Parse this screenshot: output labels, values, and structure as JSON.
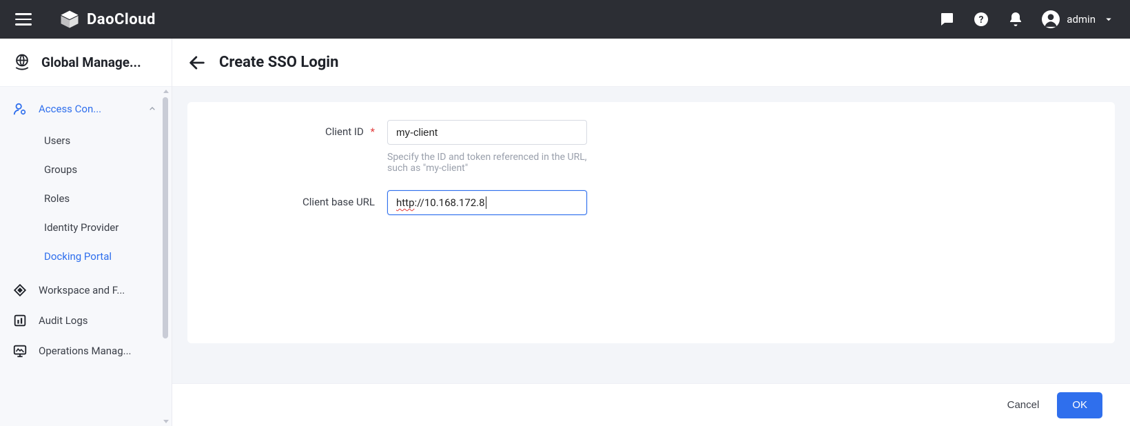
{
  "header": {
    "brand": "DaoCloud",
    "user_name": "admin"
  },
  "sidebar": {
    "title": "Global Manage...",
    "items": [
      {
        "label": "Access Con...",
        "kind": "expandable",
        "active": true
      },
      {
        "label": "Workspace and F..."
      },
      {
        "label": "Audit Logs"
      },
      {
        "label": "Operations Manag..."
      }
    ],
    "sub_items": [
      {
        "label": "Users"
      },
      {
        "label": "Groups"
      },
      {
        "label": "Roles"
      },
      {
        "label": "Identity Provider"
      },
      {
        "label": "Docking Portal",
        "active": true
      }
    ]
  },
  "page": {
    "title": "Create SSO Login"
  },
  "form": {
    "client_id": {
      "label": "Client ID",
      "required_marker": "*",
      "value": "my-client",
      "hint": "Specify the ID and token referenced in the URL, such as \"my-client\""
    },
    "client_base_url": {
      "label": "Client base URL",
      "value_prefix": "http",
      "value_rest": "://10.168.172.8"
    }
  },
  "footer": {
    "cancel": "Cancel",
    "ok": "OK"
  }
}
